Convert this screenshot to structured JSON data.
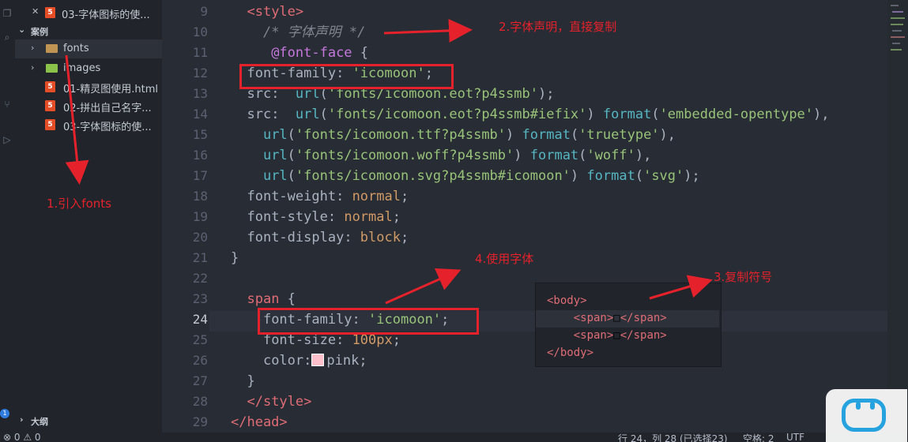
{
  "sidebar": {
    "top_item": "03-字体图标的使...",
    "section_title": "案例",
    "items": [
      {
        "label": "fonts",
        "type": "folder",
        "color": "#c09553"
      },
      {
        "label": "images",
        "type": "folder",
        "color": "#8bc34a"
      },
      {
        "label": "01-精灵图使用.html",
        "type": "html"
      },
      {
        "label": "02-拼出自己名字...",
        "type": "html"
      },
      {
        "label": "03-字体图标的使...",
        "type": "html"
      }
    ],
    "outline_title": "大纲",
    "badge_count": "1"
  },
  "editor": {
    "lines": [
      {
        "num": "9",
        "tokens": [
          {
            "t": "  "
          },
          {
            "t": "<style>",
            "c": "k"
          }
        ]
      },
      {
        "num": "10",
        "tokens": [
          {
            "t": "    "
          },
          {
            "t": "/* 字体声明 */",
            "c": "c"
          }
        ]
      },
      {
        "num": "11",
        "tokens": [
          {
            "t": "     "
          },
          {
            "t": "@font-face",
            "c": "at"
          },
          {
            "t": " {"
          }
        ]
      },
      {
        "num": "12",
        "tokens": [
          {
            "t": "  "
          },
          {
            "t": "font-family",
            "c": "p"
          },
          {
            "t": ": "
          },
          {
            "t": "'icomoon'",
            "c": "s"
          },
          {
            "t": ";"
          }
        ]
      },
      {
        "num": "13",
        "tokens": [
          {
            "t": "  "
          },
          {
            "t": "src",
            "c": "p"
          },
          {
            "t": ":  "
          },
          {
            "t": "url",
            "c": "f"
          },
          {
            "t": "("
          },
          {
            "t": "'fonts/icomoon.eot?p4ssmb'",
            "c": "s"
          },
          {
            "t": ");"
          }
        ]
      },
      {
        "num": "14",
        "tokens": [
          {
            "t": "  "
          },
          {
            "t": "src",
            "c": "p"
          },
          {
            "t": ":  "
          },
          {
            "t": "url",
            "c": "f"
          },
          {
            "t": "("
          },
          {
            "t": "'fonts/icomoon.eot?p4ssmb#iefix'",
            "c": "s"
          },
          {
            "t": ") "
          },
          {
            "t": "format",
            "c": "f"
          },
          {
            "t": "("
          },
          {
            "t": "'embedded-opentype'",
            "c": "s"
          },
          {
            "t": "),"
          }
        ]
      },
      {
        "num": "15",
        "tokens": [
          {
            "t": "    "
          },
          {
            "t": "url",
            "c": "f"
          },
          {
            "t": "("
          },
          {
            "t": "'fonts/icomoon.ttf?p4ssmb'",
            "c": "s"
          },
          {
            "t": ") "
          },
          {
            "t": "format",
            "c": "f"
          },
          {
            "t": "("
          },
          {
            "t": "'truetype'",
            "c": "s"
          },
          {
            "t": "),"
          }
        ]
      },
      {
        "num": "16",
        "tokens": [
          {
            "t": "    "
          },
          {
            "t": "url",
            "c": "f"
          },
          {
            "t": "("
          },
          {
            "t": "'fonts/icomoon.woff?p4ssmb'",
            "c": "s"
          },
          {
            "t": ") "
          },
          {
            "t": "format",
            "c": "f"
          },
          {
            "t": "("
          },
          {
            "t": "'woff'",
            "c": "s"
          },
          {
            "t": "),"
          }
        ]
      },
      {
        "num": "17",
        "tokens": [
          {
            "t": "    "
          },
          {
            "t": "url",
            "c": "f"
          },
          {
            "t": "("
          },
          {
            "t": "'fonts/icomoon.svg?p4ssmb#icomoon'",
            "c": "s"
          },
          {
            "t": ") "
          },
          {
            "t": "format",
            "c": "f"
          },
          {
            "t": "("
          },
          {
            "t": "'svg'",
            "c": "s"
          },
          {
            "t": ");"
          }
        ]
      },
      {
        "num": "18",
        "tokens": [
          {
            "t": "  "
          },
          {
            "t": "font-weight",
            "c": "p"
          },
          {
            "t": ": "
          },
          {
            "t": "normal",
            "c": "n"
          },
          {
            "t": ";"
          }
        ]
      },
      {
        "num": "19",
        "tokens": [
          {
            "t": "  "
          },
          {
            "t": "font-style",
            "c": "p"
          },
          {
            "t": ": "
          },
          {
            "t": "normal",
            "c": "n"
          },
          {
            "t": ";"
          }
        ]
      },
      {
        "num": "20",
        "tokens": [
          {
            "t": "  "
          },
          {
            "t": "font-display",
            "c": "p"
          },
          {
            "t": ": "
          },
          {
            "t": "block",
            "c": "n"
          },
          {
            "t": ";"
          }
        ]
      },
      {
        "num": "21",
        "tokens": [
          {
            "t": "}"
          }
        ]
      },
      {
        "num": "22",
        "tokens": []
      },
      {
        "num": "23",
        "tokens": [
          {
            "t": "  "
          },
          {
            "t": "span",
            "c": "k"
          },
          {
            "t": " {"
          }
        ]
      },
      {
        "num": "24",
        "tokens": [
          {
            "t": "    "
          },
          {
            "t": "font-family",
            "c": "p"
          },
          {
            "t": ": "
          },
          {
            "t": "'icomoon'",
            "c": "s"
          },
          {
            "t": ";"
          }
        ],
        "active": true
      },
      {
        "num": "25",
        "tokens": [
          {
            "t": "    "
          },
          {
            "t": "font-size",
            "c": "p"
          },
          {
            "t": ": "
          },
          {
            "t": "100px",
            "c": "n"
          },
          {
            "t": ";"
          }
        ]
      },
      {
        "num": "26",
        "tokens": [
          {
            "t": "    "
          },
          {
            "t": "color",
            "c": "p"
          },
          {
            "t": ":"
          },
          {
            "swatch": "#ffc0cb"
          },
          {
            "t": "pink",
            "c": "p"
          },
          {
            "t": ";"
          }
        ]
      },
      {
        "num": "27",
        "tokens": [
          {
            "t": "  "
          },
          {
            "t": "}"
          }
        ]
      },
      {
        "num": "28",
        "tokens": [
          {
            "t": "  "
          },
          {
            "t": "</style>",
            "c": "k"
          }
        ]
      },
      {
        "num": "29",
        "tokens": [
          {
            "t": "</head>",
            "c": "k"
          }
        ]
      }
    ]
  },
  "popup": {
    "lines": [
      {
        "tokens": [
          {
            "t": "<body>",
            "c": "k"
          }
        ]
      },
      {
        "tokens": [
          {
            "t": "    "
          },
          {
            "t": "<span>",
            "c": "k"
          },
          {
            "t": "□"
          },
          {
            "t": "</span>",
            "c": "k"
          }
        ]
      },
      {
        "tokens": [
          {
            "t": "    "
          },
          {
            "t": "<span>",
            "c": "k"
          },
          {
            "t": "□"
          },
          {
            "t": "</span>",
            "c": "k"
          }
        ]
      },
      {
        "tokens": [
          {
            "t": "</body>",
            "c": "k"
          }
        ]
      }
    ]
  },
  "annotations": {
    "a1": "1.引入fonts",
    "a2": "2.字体声明，直接复制",
    "a3": "3.复制符号",
    "a4": "4.使用字体"
  },
  "statusbar": {
    "errors": "0",
    "warnings": "0",
    "position": "行 24，列 28 (已选择23)",
    "spaces": "空格: 2",
    "encoding": "UTF"
  }
}
